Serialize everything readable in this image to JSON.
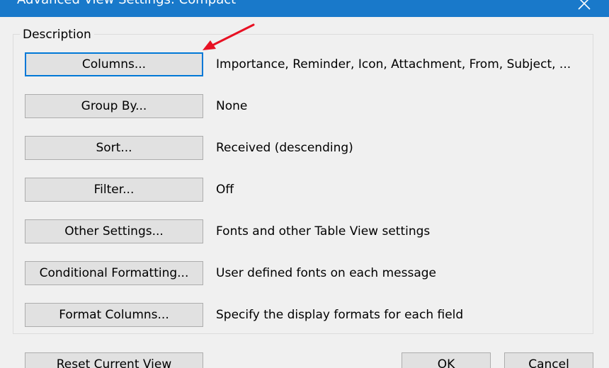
{
  "window": {
    "title": "Advanced View Settings: Compact"
  },
  "group": {
    "label": "Description"
  },
  "rows": [
    {
      "button": "Columns...",
      "value": "Importance, Reminder, Icon, Attachment, From, Subject, ..."
    },
    {
      "button": "Group By...",
      "value": "None"
    },
    {
      "button": "Sort...",
      "value": "Received (descending)"
    },
    {
      "button": "Filter...",
      "value": "Off"
    },
    {
      "button": "Other Settings...",
      "value": "Fonts and other Table View settings"
    },
    {
      "button": "Conditional Formatting...",
      "value": "User defined fonts on each message"
    },
    {
      "button": "Format Columns...",
      "value": "Specify the display formats for each field"
    }
  ],
  "footer": {
    "reset_label": "Reset Current View",
    "ok_label": "OK",
    "cancel_label": "Cancel"
  },
  "colors": {
    "titlebar": "#1979ca",
    "focus_border": "#0078d7",
    "annotation_arrow": "#e81123"
  },
  "icons": {
    "close": "close-icon",
    "annotation": "red-arrow-icon"
  }
}
